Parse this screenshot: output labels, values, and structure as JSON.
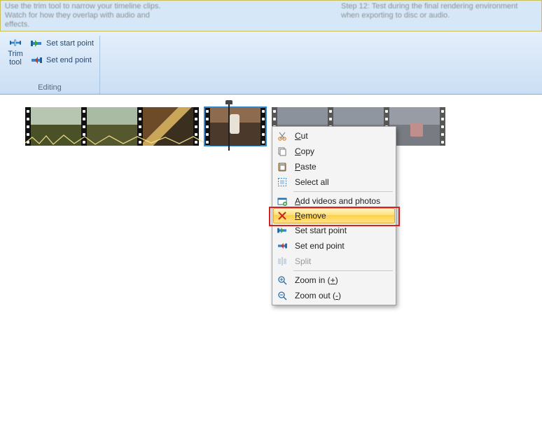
{
  "topstrip": {
    "blurb1": "Use the trim tool to narrow your timeline clips. Watch for how they overlap with audio and effects.",
    "blurb2": "Step 12: Test during the final rendering environment when exporting to disc or audio."
  },
  "ribbon": {
    "trim_tool": "Trim\ntool",
    "set_start": "Set start point",
    "set_end": "Set end point",
    "group_label": "Editing"
  },
  "context_menu": {
    "cut": "Cut",
    "copy": "Copy",
    "paste": "Paste",
    "select_all": "Select all",
    "add_media": "Add videos and photos",
    "remove": "Remove",
    "set_start": "Set start point",
    "set_end": "Set end point",
    "split": "Split",
    "zoom_in": "Zoom in (",
    "zoom_in_accel": "+",
    "zoom_out": "Zoom out (",
    "zoom_out_accel": "-"
  }
}
